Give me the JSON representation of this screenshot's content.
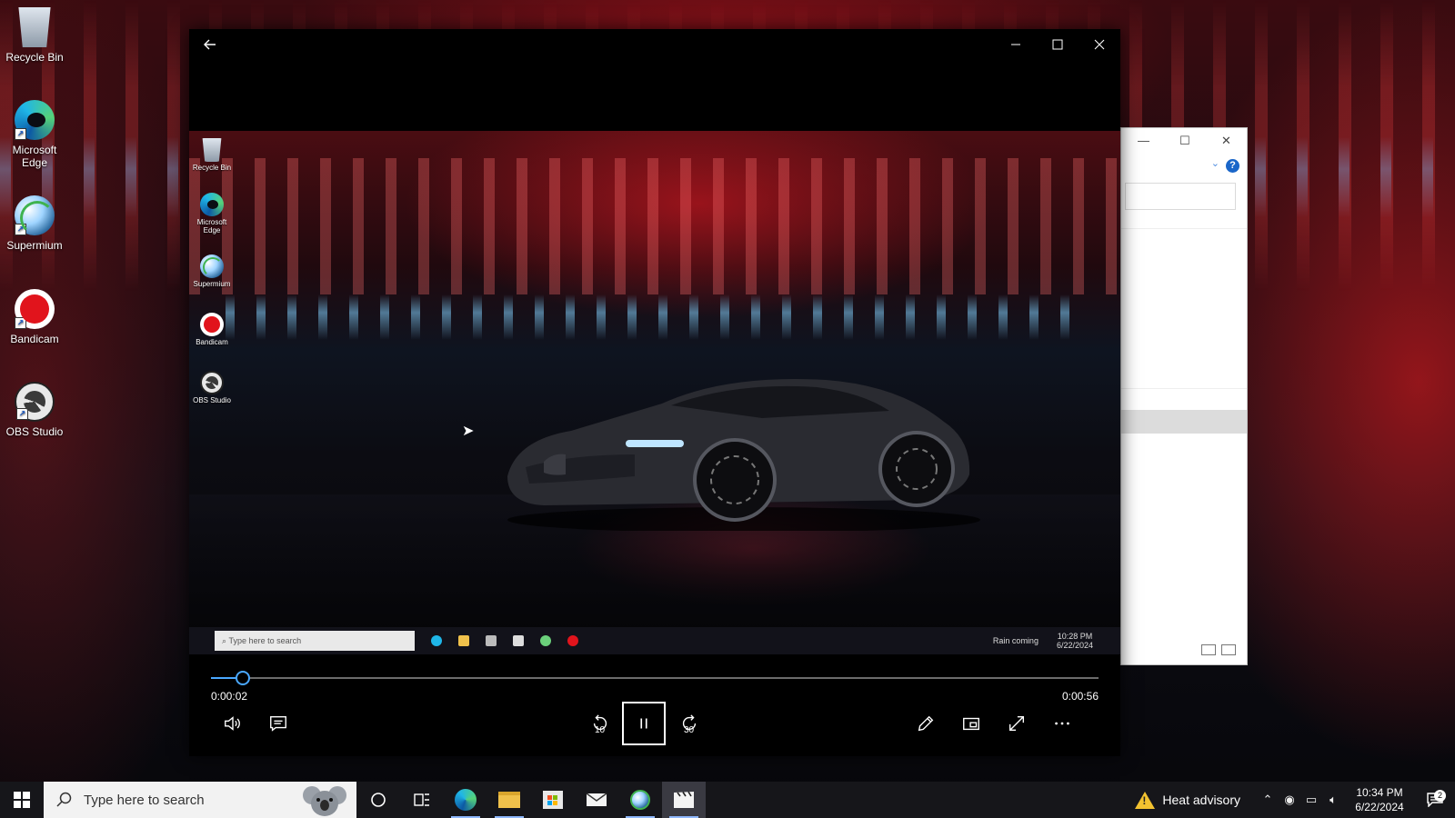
{
  "desktop": {
    "icons": [
      {
        "label": "Recycle Bin",
        "icon": "recycle-bin-icon"
      },
      {
        "label": "Microsoft Edge",
        "icon": "edge-icon"
      },
      {
        "label": "Supermium",
        "icon": "supermium-icon"
      },
      {
        "label": "Bandicam",
        "icon": "bandicam-icon"
      },
      {
        "label": "OBS Studio",
        "icon": "obs-studio-icon"
      }
    ]
  },
  "player": {
    "video": {
      "desktop_icons": [
        "Recycle Bin",
        "Microsoft Edge",
        "Supermium",
        "Bandicam",
        "OBS Studio"
      ],
      "taskbar": {
        "search_placeholder": "Type here to search",
        "weather": "Rain coming",
        "time": "10:28 PM",
        "date": "6/22/2024"
      }
    },
    "current_time": "0:00:02",
    "total_time": "0:00:56",
    "progress": 0.036,
    "controls": {
      "skip_back_seconds": "10",
      "skip_forward_seconds": "30"
    }
  },
  "taskbar": {
    "search_placeholder": "Type here to search",
    "weather": "Heat advisory",
    "time": "10:34 PM",
    "date": "6/22/2024",
    "notification_count": "2",
    "accent": "#8fb8ff"
  },
  "colors": {
    "player_accent": "#4aa8ff",
    "warning": "#f2c230"
  }
}
